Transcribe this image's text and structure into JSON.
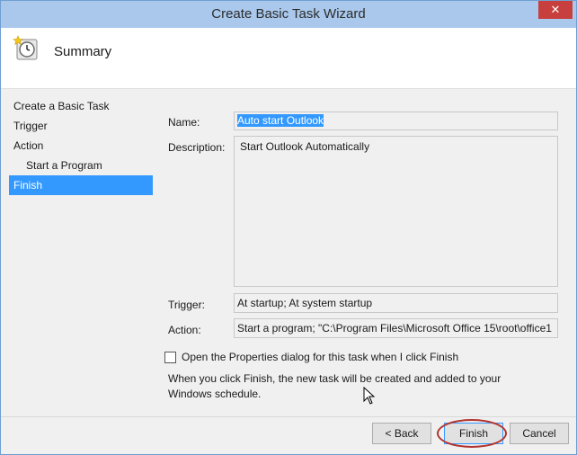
{
  "window": {
    "title": "Create Basic Task Wizard",
    "close_glyph": "✕"
  },
  "header": {
    "title": "Summary",
    "icon": "task-scheduler-clock-icon"
  },
  "steps": [
    {
      "label": "Create a Basic Task"
    },
    {
      "label": "Trigger"
    },
    {
      "label": "Action"
    },
    {
      "label": "Start a Program"
    },
    {
      "label": "Finish"
    }
  ],
  "form": {
    "name_label": "Name:",
    "name_value": "Auto start Outlook",
    "description_label": "Description:",
    "description_value": "Start Outlook Automatically",
    "trigger_label": "Trigger:",
    "trigger_value": "At startup; At system startup",
    "action_label": "Action:",
    "action_value": "Start a program; \"C:\\Program Files\\Microsoft Office 15\\root\\office1"
  },
  "options": {
    "checkbox_label": "Open the Properties dialog for this task when I click Finish",
    "checked": false,
    "info_line1": "When you click Finish, the new task will be created and added to your",
    "info_line2": "Windows schedule."
  },
  "buttons": {
    "back": "< Back",
    "finish": "Finish",
    "cancel": "Cancel"
  },
  "colors": {
    "selection": "#3399ff",
    "titlebar": "#a9c8ec",
    "close": "#c8403d",
    "highlight": "#b2322c"
  }
}
